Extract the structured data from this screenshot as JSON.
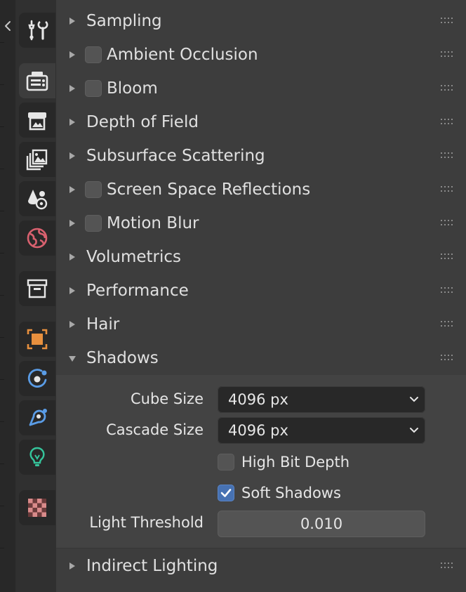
{
  "navigation": {
    "collapse_icon": "chevron-left-icon",
    "tabs": [
      {
        "name": "tool",
        "icon": "wrench-screwdriver-icon",
        "color": "#e6e6e6",
        "active": false
      },
      {
        "name": "render",
        "icon": "camera-back-icon",
        "color": "#e6e6e6",
        "active": true
      },
      {
        "name": "output",
        "icon": "printer-icon",
        "color": "#e6e6e6",
        "active": false
      },
      {
        "name": "view-layer",
        "icon": "image-stack-icon",
        "color": "#e6e6e6",
        "active": false
      },
      {
        "name": "scene",
        "icon": "scene-shapes-icon",
        "color": "#e6e6e6",
        "active": false
      },
      {
        "name": "world",
        "icon": "globe-icon",
        "color": "#d9616f",
        "active": false
      },
      {
        "name": "collection",
        "icon": "archive-box-icon",
        "color": "#e6e6e6",
        "active": false
      },
      {
        "name": "object",
        "icon": "object-square-icon",
        "color": "#e8903e",
        "active": false
      },
      {
        "name": "physics",
        "icon": "orbit-icon",
        "color": "#5a9ce6",
        "active": false
      },
      {
        "name": "constraints",
        "icon": "constraint-icon",
        "color": "#5a9ce6",
        "active": false
      },
      {
        "name": "data",
        "icon": "lightbulb-icon",
        "color": "#35c49b",
        "active": false
      },
      {
        "name": "texture",
        "icon": "checker-icon",
        "color": "#d98a8a",
        "active": false
      }
    ]
  },
  "sections": [
    {
      "label": "Sampling",
      "expanded": false,
      "has_checkbox": false
    },
    {
      "label": "Ambient Occlusion",
      "expanded": false,
      "has_checkbox": true,
      "checked": false
    },
    {
      "label": "Bloom",
      "expanded": false,
      "has_checkbox": true,
      "checked": false
    },
    {
      "label": "Depth of Field",
      "expanded": false,
      "has_checkbox": false
    },
    {
      "label": "Subsurface Scattering",
      "expanded": false,
      "has_checkbox": false
    },
    {
      "label": "Screen Space Reflections",
      "expanded": false,
      "has_checkbox": true,
      "checked": false
    },
    {
      "label": "Motion Blur",
      "expanded": false,
      "has_checkbox": true,
      "checked": false
    },
    {
      "label": "Volumetrics",
      "expanded": false,
      "has_checkbox": false
    },
    {
      "label": "Performance",
      "expanded": false,
      "has_checkbox": false
    },
    {
      "label": "Hair",
      "expanded": false,
      "has_checkbox": false
    },
    {
      "label": "Shadows",
      "expanded": true,
      "has_checkbox": false
    },
    {
      "label": "Indirect Lighting",
      "expanded": false,
      "has_checkbox": false
    }
  ],
  "shadows": {
    "cube_size": {
      "label": "Cube Size",
      "value": "4096 px"
    },
    "cascade_size": {
      "label": "Cascade Size",
      "value": "4096 px"
    },
    "high_bit_depth": {
      "label": "High Bit Depth",
      "checked": false
    },
    "soft_shadows": {
      "label": "Soft Shadows",
      "checked": true
    },
    "light_threshold": {
      "label": "Light Threshold",
      "value": "0.010"
    }
  },
  "colors": {
    "accent": "#4772b3",
    "panel_bg": "#3d3d3d",
    "sub_panel_bg": "#434343",
    "field_bg": "#282828"
  }
}
